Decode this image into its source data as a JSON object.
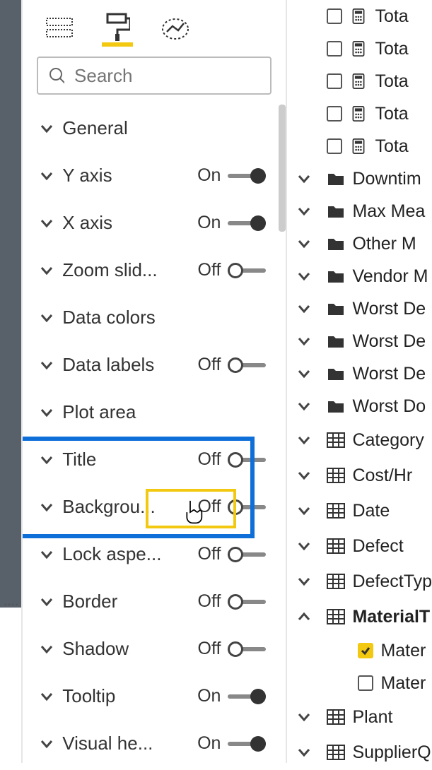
{
  "search": {
    "placeholder": "Search"
  },
  "sections": [
    {
      "label": "General",
      "toggle": null
    },
    {
      "label": "Y axis",
      "toggle": "On"
    },
    {
      "label": "X axis",
      "toggle": "On"
    },
    {
      "label": "Zoom slid...",
      "toggle": "Off"
    },
    {
      "label": "Data colors",
      "toggle": null
    },
    {
      "label": "Data labels",
      "toggle": "Off"
    },
    {
      "label": "Plot area",
      "toggle": null
    },
    {
      "label": "Title",
      "toggle": "Off"
    },
    {
      "label": "Backgrou...",
      "toggle": "Off"
    },
    {
      "label": "Lock aspe...",
      "toggle": "Off"
    },
    {
      "label": "Border",
      "toggle": "Off"
    },
    {
      "label": "Shadow",
      "toggle": "Off"
    },
    {
      "label": "Tooltip",
      "toggle": "On"
    },
    {
      "label": "Visual he...",
      "toggle": "On"
    }
  ],
  "fields": {
    "measures": [
      {
        "label": "Tota"
      },
      {
        "label": "Tota"
      },
      {
        "label": "Tota"
      },
      {
        "label": "Tota"
      },
      {
        "label": "Tota"
      }
    ],
    "folders": [
      {
        "label": "Downtim"
      },
      {
        "label": "Max Mea"
      },
      {
        "label": "Other M"
      },
      {
        "label": "Vendor M"
      },
      {
        "label": "Worst De"
      },
      {
        "label": "Worst De"
      },
      {
        "label": "Worst De"
      },
      {
        "label": "Worst Do"
      }
    ],
    "tables": [
      {
        "label": "Category"
      },
      {
        "label": "Cost/Hr"
      },
      {
        "label": "Date"
      },
      {
        "label": "Defect"
      },
      {
        "label": "DefectTyp"
      },
      {
        "label": "MaterialT",
        "expanded": true,
        "children": [
          {
            "label": "Mater",
            "checked": true
          },
          {
            "label": "Mater",
            "checked": false
          }
        ]
      },
      {
        "label": "Plant"
      },
      {
        "label": "SupplierQ"
      }
    ]
  }
}
